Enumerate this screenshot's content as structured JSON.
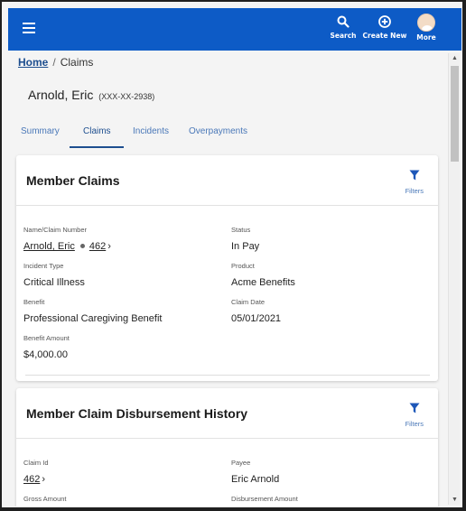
{
  "header": {
    "search_label": "Search",
    "create_label": "Create New",
    "more_label": "More",
    "brand_color": "#0d5bc6"
  },
  "breadcrumb": {
    "home": "Home",
    "separator": "/",
    "current": "Claims"
  },
  "member": {
    "name": "Arnold, Eric",
    "ssn": "(XXX-XX-2938)"
  },
  "tabs": [
    {
      "label": "Summary",
      "active": false
    },
    {
      "label": "Claims",
      "active": true
    },
    {
      "label": "Incidents",
      "active": false
    },
    {
      "label": "Overpayments",
      "active": false
    }
  ],
  "claims_card": {
    "title": "Member Claims",
    "filters_label": "Filters",
    "name_claim_label": "Name/Claim Number",
    "member_link": "Arnold, Eric",
    "claim_number": "462",
    "status_label": "Status",
    "status_value": "In Pay",
    "incident_type_label": "Incident Type",
    "incident_type_value": "Critical Illness",
    "product_label": "Product",
    "product_value": "Acme Benefits",
    "benefit_label": "Benefit",
    "benefit_value": "Professional Caregiving Benefit",
    "claim_date_label": "Claim Date",
    "claim_date_value": "05/01/2021",
    "benefit_amount_label": "Benefit Amount",
    "benefit_amount_value": "$4,000.00"
  },
  "disbursement_card": {
    "title": "Member Claim Disbursement History",
    "filters_label": "Filters",
    "claim_id_label": "Claim Id",
    "claim_id_value": "462",
    "payee_label": "Payee",
    "payee_value": "Eric Arnold",
    "gross_amount_label": "Gross Amount",
    "disbursement_amount_label": "Disbursement Amount"
  }
}
